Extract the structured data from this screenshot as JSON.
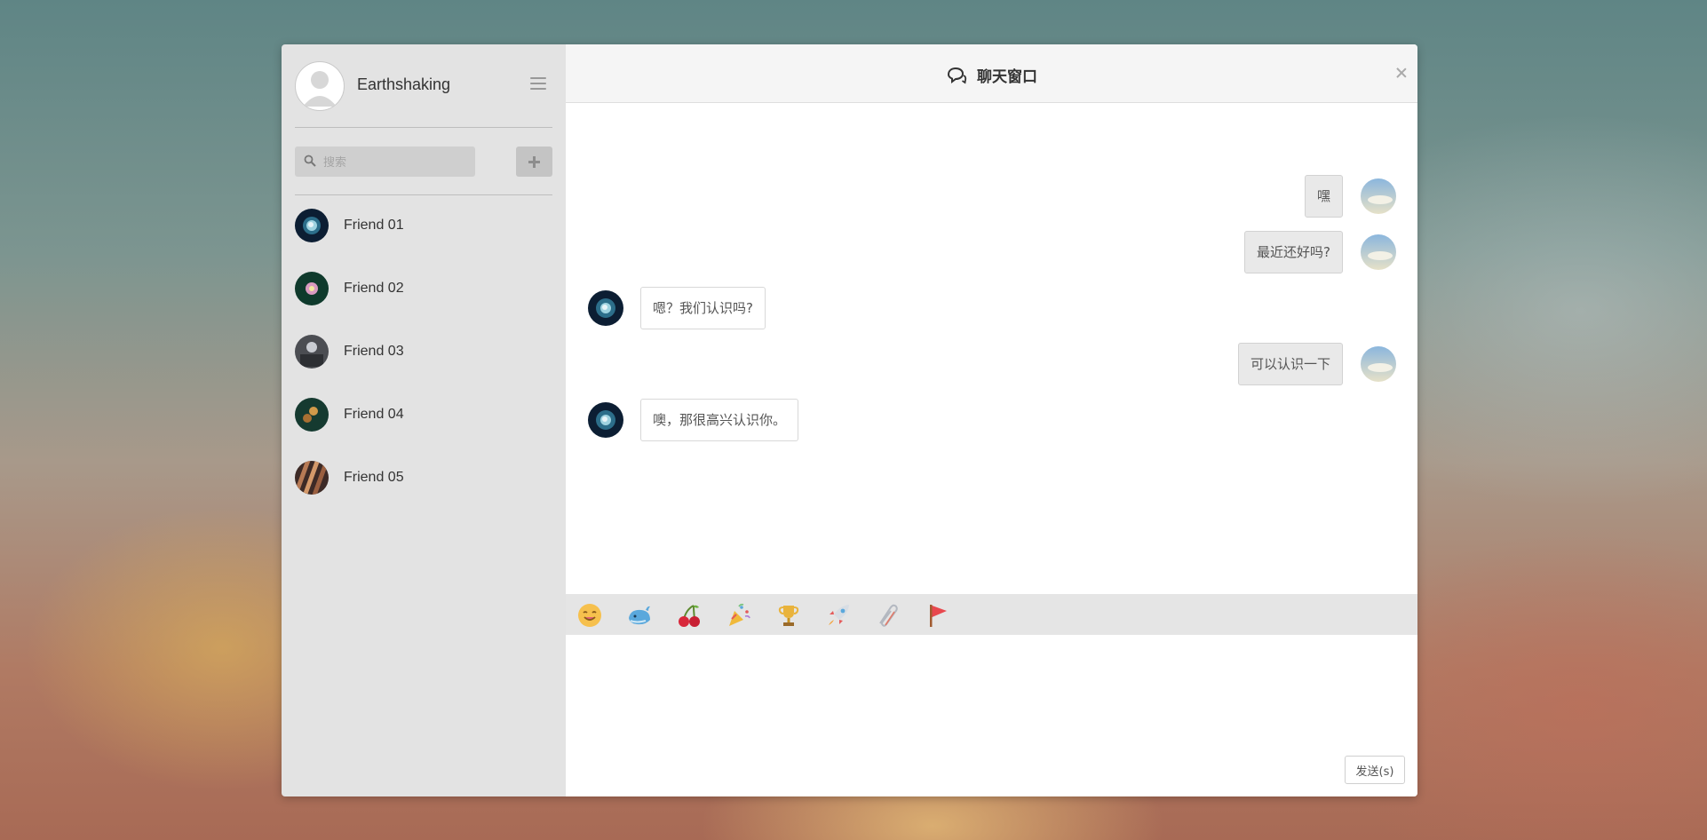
{
  "sidebar": {
    "username": "Earthshaking",
    "search_placeholder": "搜索",
    "friends": [
      {
        "name": "Friend 01"
      },
      {
        "name": "Friend 02"
      },
      {
        "name": "Friend 03"
      },
      {
        "name": "Friend 04"
      },
      {
        "name": "Friend 05"
      }
    ]
  },
  "header": {
    "title": "聊天窗口"
  },
  "messages": [
    {
      "direction": "out",
      "text": "嘿"
    },
    {
      "direction": "out",
      "text": "最近还好吗?"
    },
    {
      "direction": "in",
      "text": "嗯？我们认识吗?"
    },
    {
      "direction": "out",
      "text": "可以认识一下"
    },
    {
      "direction": "in",
      "text": "噢，那很高兴认识你。"
    }
  ],
  "toolbar": {
    "emoji_icons": [
      "smile-icon",
      "whale-icon",
      "cherry-icon",
      "party-popper-icon",
      "trophy-icon",
      "rocket-icon",
      "paperclip-icon",
      "flag-icon"
    ]
  },
  "composer": {
    "send_label": "发送(s)"
  }
}
